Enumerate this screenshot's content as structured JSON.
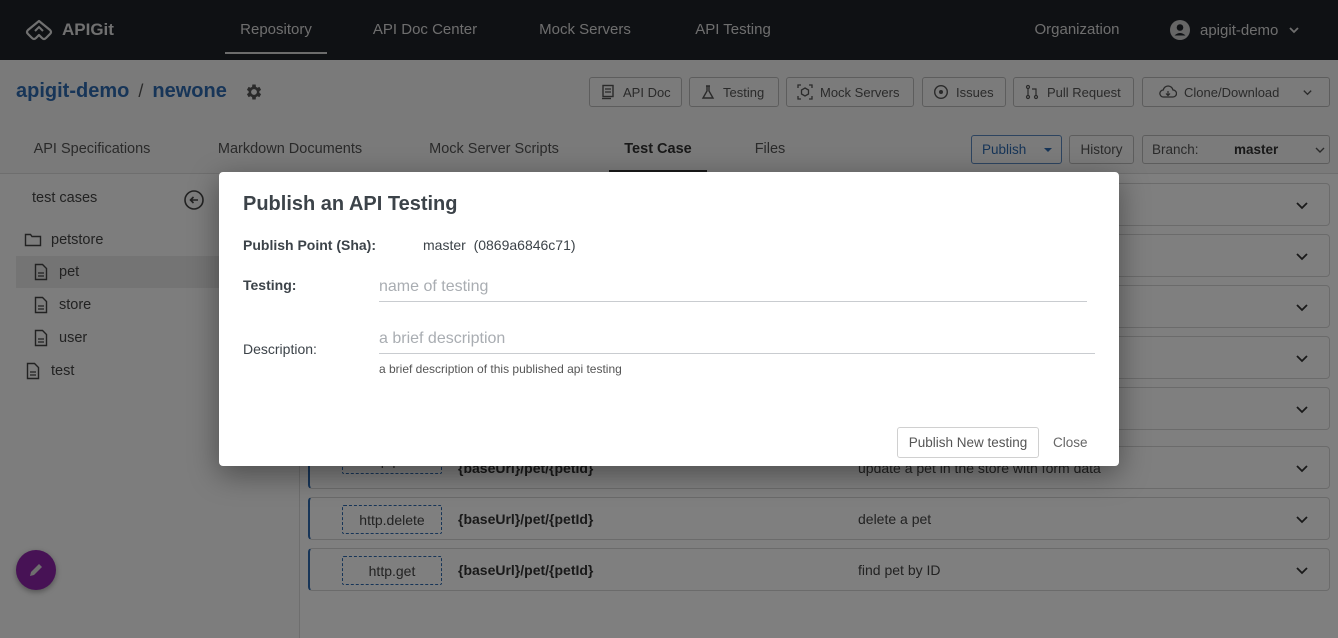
{
  "topnav": {
    "brand": "APIGit",
    "items": [
      {
        "label": "Repository",
        "active": true
      },
      {
        "label": "API Doc Center",
        "active": false
      },
      {
        "label": "Mock Servers",
        "active": false
      },
      {
        "label": "API Testing",
        "active": false
      }
    ],
    "organization": "Organization",
    "user": "apigit-demo"
  },
  "repo": {
    "owner": "apigit-demo",
    "separator": "/",
    "name": "newone",
    "actions": [
      {
        "label": "API Doc",
        "icon": "api-doc-icon"
      },
      {
        "label": "Testing",
        "icon": "flask-icon"
      },
      {
        "label": "Mock Servers",
        "icon": "mock-server-icon"
      },
      {
        "label": "Issues",
        "icon": "issues-icon"
      },
      {
        "label": "Pull Request",
        "icon": "pull-request-icon"
      },
      {
        "label": "Clone/Download",
        "icon": "cloud-download-icon"
      }
    ]
  },
  "tabs": [
    {
      "label": "API Specifications",
      "active": false
    },
    {
      "label": "Markdown Documents",
      "active": false
    },
    {
      "label": "Mock Server Scripts",
      "active": false
    },
    {
      "label": "Test Case",
      "active": true
    },
    {
      "label": "Files",
      "active": false
    }
  ],
  "toolbar": {
    "publish_label": "Publish",
    "history_label": "History",
    "branch_label": "Branch:",
    "branch_value": "master"
  },
  "sidebar": {
    "title": "test cases",
    "tree": [
      {
        "label": "petstore",
        "type": "folder",
        "level": 0
      },
      {
        "label": "pet",
        "type": "file",
        "level": 1,
        "selected": true
      },
      {
        "label": "store",
        "type": "file",
        "level": 1
      },
      {
        "label": "user",
        "type": "file",
        "level": 1
      },
      {
        "label": "test",
        "type": "file",
        "level": 0
      }
    ]
  },
  "cases": [
    {
      "method": "http.post",
      "path": "{baseUrl}/pet/{petId}",
      "summary": "update a pet in the store with form data"
    },
    {
      "method": "http.delete",
      "path": "{baseUrl}/pet/{petId}",
      "summary": "delete a pet"
    },
    {
      "method": "http.get",
      "path": "{baseUrl}/pet/{petId}",
      "summary": "find pet by ID"
    }
  ],
  "dialog": {
    "title": "Publish an API Testing",
    "sha_label": "Publish Point (Sha):",
    "sha_value": "master  (0869a6846c71)",
    "testing_label": "Testing:",
    "testing_placeholder": "name of testing",
    "testing_value": "",
    "description_label": "Description:",
    "description_placeholder": "a brief description",
    "description_value": "",
    "description_hint": "a brief description of this published api testing",
    "publish_button": "Publish New testing",
    "close_button": "Close"
  },
  "colors": {
    "nav_bg": "#1f2229",
    "link_blue": "#2e6ab0",
    "fab_purple": "#8e24aa"
  }
}
